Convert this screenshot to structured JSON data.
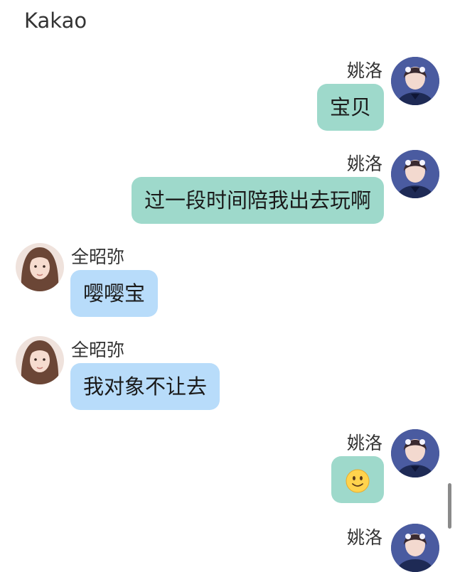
{
  "app": {
    "title": "Kakao"
  },
  "messages": [
    {
      "direction": "out",
      "sender": "姚洛",
      "text": "宝贝"
    },
    {
      "direction": "out",
      "sender": "姚洛",
      "text": "过一段时间陪我出去玩啊"
    },
    {
      "direction": "in",
      "sender": "全昭弥",
      "text": "嘤嘤宝"
    },
    {
      "direction": "in",
      "sender": "全昭弥",
      "text": "我对象不让去"
    },
    {
      "direction": "out",
      "sender": "姚洛",
      "emoji": "slightly-smiling-face-emoji"
    },
    {
      "direction": "out",
      "sender": "姚洛"
    }
  ],
  "colors": {
    "outgoing_bubble": "#9ed9cb",
    "incoming_bubble": "#b8dcfa",
    "background": "#ffffff"
  }
}
